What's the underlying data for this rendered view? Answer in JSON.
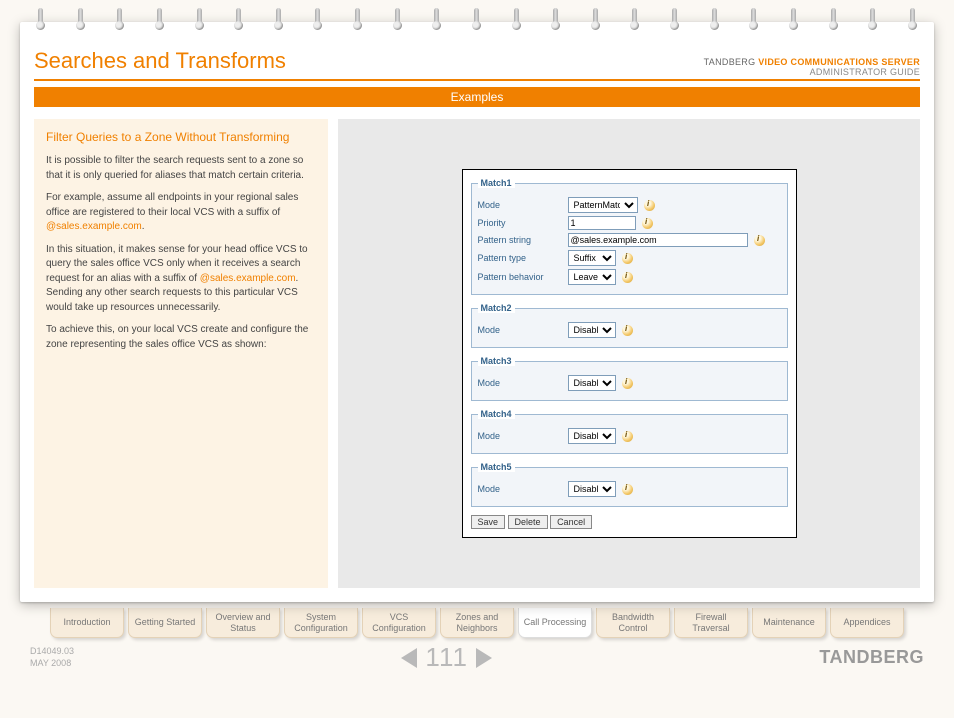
{
  "header": {
    "title": "Searches and Transforms",
    "brand": "TANDBERG",
    "product": "VIDEO COMMUNICATIONS SERVER",
    "subtitle": "ADMINISTRATOR GUIDE",
    "section_bar": "Examples"
  },
  "sidebar": {
    "title": "Filter Queries to a Zone Without Transforming",
    "p1": "It is possible to filter the search requests sent to a zone so that it is only queried for aliases that match certain criteria.",
    "p2a": "For example, assume all endpoints in your regional sales office are registered to their local VCS with a suffix of ",
    "p2_link": "@sales.example.com",
    "p2b": ".",
    "p3a": "In this situation, it makes sense for your head office VCS to query the sales office VCS only when it receives a search request for an alias with a suffix of ",
    "p3_link": "@sales.example.com",
    "p3b": ". Sending any other search requests to this particular VCS would take up resources unnecessarily.",
    "p4": "To achieve this, on your local VCS create and configure the zone representing the sales office VCS as shown:"
  },
  "config": {
    "match1": {
      "legend": "Match1",
      "mode_label": "Mode",
      "mode_value": "PatternMatch",
      "priority_label": "Priority",
      "priority_value": "1",
      "pstring_label": "Pattern string",
      "pstring_value": "@sales.example.com",
      "ptype_label": "Pattern type",
      "ptype_value": "Suffix",
      "pbehavior_label": "Pattern behavior",
      "pbehavior_value": "Leave"
    },
    "match2": {
      "legend": "Match2",
      "mode_label": "Mode",
      "mode_value": "Disabled"
    },
    "match3": {
      "legend": "Match3",
      "mode_label": "Mode",
      "mode_value": "Disabled"
    },
    "match4": {
      "legend": "Match4",
      "mode_label": "Mode",
      "mode_value": "Disabled"
    },
    "match5": {
      "legend": "Match5",
      "mode_label": "Mode",
      "mode_value": "Disabled"
    },
    "buttons": {
      "save": "Save",
      "delete": "Delete",
      "cancel": "Cancel"
    }
  },
  "tabs": {
    "t0": "Introduction",
    "t1": "Getting Started",
    "t2": "Overview and Status",
    "t3": "System Configuration",
    "t4": "VCS Configuration",
    "t5": "Zones and Neighbors",
    "t6": "Call Processing",
    "t7": "Bandwidth Control",
    "t8": "Firewall Traversal",
    "t9": "Maintenance",
    "t10": "Appendices"
  },
  "footer": {
    "doc_id": "D14049.03",
    "doc_date": "MAY 2008",
    "page_num": "111",
    "brand": "TANDBERG"
  }
}
